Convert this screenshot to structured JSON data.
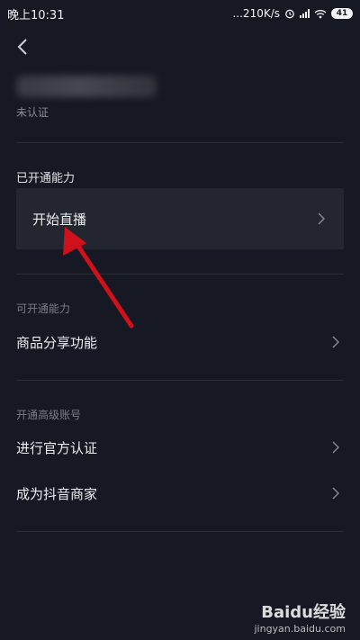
{
  "status_bar": {
    "time": "晚上10:31",
    "net_speed": "...210K/s",
    "battery": "41"
  },
  "profile": {
    "verify_status": "未认证"
  },
  "sections": {
    "enabled": {
      "title": "已开通能力",
      "items": [
        {
          "label": "开始直播"
        }
      ]
    },
    "available": {
      "title": "可开通能力",
      "items": [
        {
          "label": "商品分享功能"
        }
      ]
    },
    "advanced": {
      "title": "开通高级账号",
      "items": [
        {
          "label": "进行官方认证"
        },
        {
          "label": "成为抖音商家"
        }
      ]
    }
  },
  "annotation": {
    "arrow_color": "#d0101a"
  },
  "watermark": {
    "brand": "Baidu经验",
    "domain": "jingyan.baidu.com"
  }
}
